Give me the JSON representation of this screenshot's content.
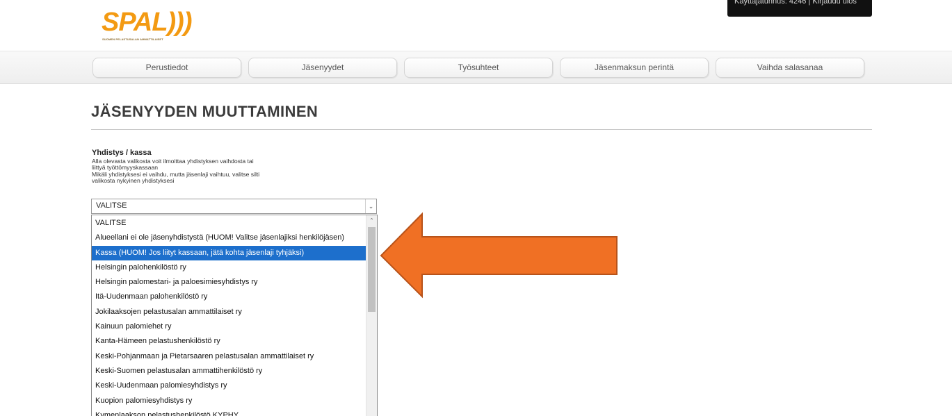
{
  "logo": {
    "wordmark": "SPAL)))",
    "tagline": "SUOMEN PELASTUSALAN AMMATTILAISET",
    "color": "#f39a12"
  },
  "user_bar": {
    "text": "Käyttäjätunnus: 4246 | Kirjaudu ulos"
  },
  "nav": {
    "tabs": [
      {
        "label": "Perustiedot"
      },
      {
        "label": "Jäsenyydet"
      },
      {
        "label": "Työsuhteet"
      },
      {
        "label": "Jäsenmaksun perintä"
      },
      {
        "label": "Vaihda salasanaa"
      }
    ]
  },
  "page": {
    "title": "JÄSENYYDEN MUUTTAMINEN"
  },
  "field": {
    "label": "Yhdistys / kassa",
    "help_lines": [
      "Alla olevasta valikosta voit ilmoittaa yhdistyksen vaihdosta tai",
      "liittyä työttömyyskassaan",
      "Mikäli yhdistyksesi ei vaihdu, mutta jäsenlaji vaihtuu, valitse silti",
      "valikosta nykyinen yhdistyksesi"
    ]
  },
  "select": {
    "value": "VALITSE",
    "options": [
      "VALITSE",
      "Alueellani ei ole jäsenyhdistystä (HUOM! Valitse jäsenlajiksi henkilöjäsen)",
      "Kassa (HUOM! Jos liityt kassaan, jätä kohta jäsenlaji tyhjäksi)",
      "Helsingin palohenkilöstö ry",
      "Helsingin palomestari- ja paloesimiesyhdistys ry",
      "Itä-Uudenmaan palohenkilöstö ry",
      "Jokilaaksojen pelastusalan ammattilaiset ry",
      "Kainuun palomiehet ry",
      "Kanta-Hämeen pelastushenkilöstö ry",
      "Keski-Pohjanmaan ja Pietarsaaren pelastusalan ammattilaiset ry",
      "Keski-Suomen pelastusalan ammattihenkilöstö ry",
      "Keski-Uudenmaan palomiesyhdistys ry",
      "Kuopion palomiesyhdistys ry",
      "Kymenlaakson pelastushenkilöstö KYPHY"
    ],
    "highlighted_index": 2
  },
  "colors": {
    "highlight": "#1d6fcc",
    "arrow_fill": "#f07024",
    "arrow_stroke": "#b8531a"
  }
}
